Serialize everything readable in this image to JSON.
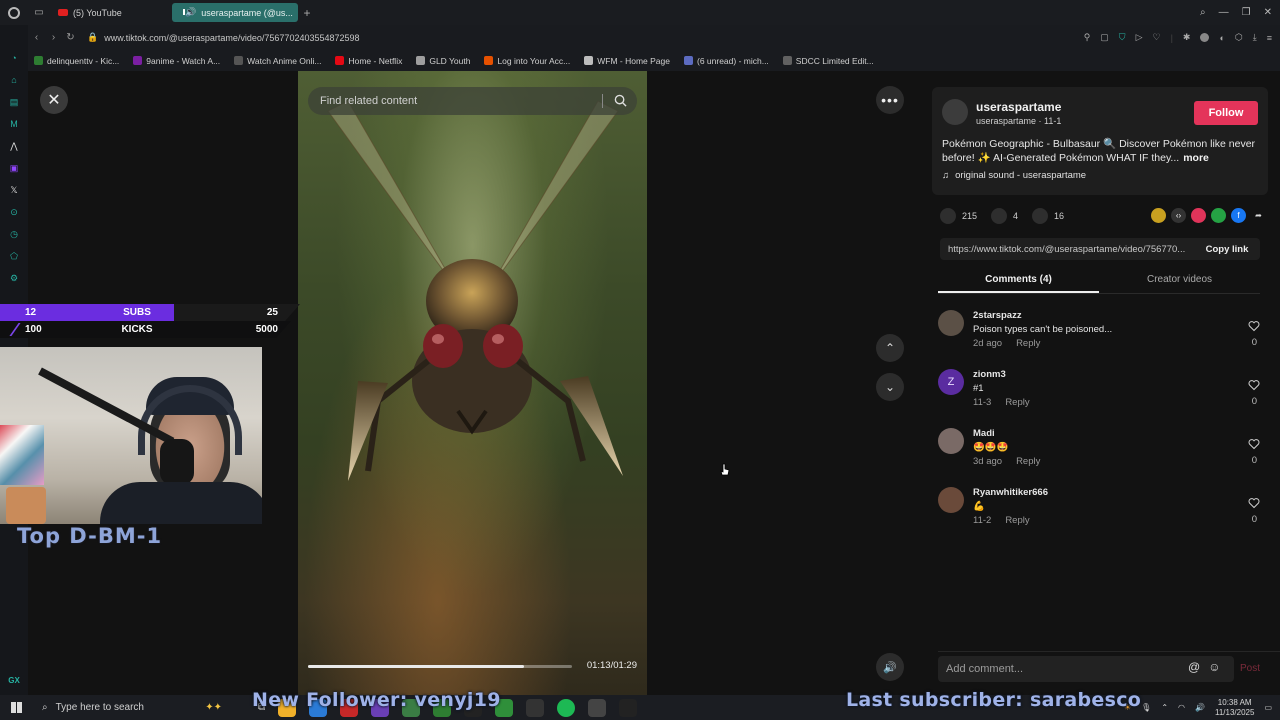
{
  "browser": {
    "tabs": [
      {
        "label": "(5) YouTube"
      },
      {
        "label": "useraspartame (@us..."
      }
    ],
    "new_tab": "+",
    "url": "www.tiktok.com/@useraspartame/video/7567702403554872598",
    "bookmarks": [
      {
        "label": "delinquenttv - Kic...",
        "color": "#2e7d32"
      },
      {
        "label": "9anime - Watch A...",
        "color": "#7b1fa2"
      },
      {
        "label": "Watch Anime Onli...",
        "color": "#555555"
      },
      {
        "label": "Home - Netflix",
        "color": "#e50914"
      },
      {
        "label": "GLD Youth",
        "color": "#9e9e9e"
      },
      {
        "label": "Log into Your Acc...",
        "color": "#e65100"
      },
      {
        "label": "WFM - Home Page",
        "color": "#bdbdbd"
      },
      {
        "label": "(6 unread) - mich...",
        "color": "#5c6bc0"
      },
      {
        "label": "SDCC Limited Edit...",
        "color": "#616161"
      }
    ],
    "sidebar_bottom": "GX"
  },
  "video": {
    "search_placeholder": "Find related content",
    "time": "01:13/01:29",
    "progress": 0.82
  },
  "post": {
    "username": "useraspartame",
    "subline": "useraspartame · 11-1",
    "follow_label": "Follow",
    "description": "Pokémon Geographic - Bulbasaur 🔍 Discover Pokémon like never before! ✨ AI-Generated Pokémon WHAT IF they...",
    "more_label": "more",
    "sound": "original sound - useraspartame",
    "likes": "215",
    "comments_count": "4",
    "saves": "16",
    "link": "https://www.tiktok.com/@useraspartame/video/756770...",
    "copy_label": "Copy link",
    "tab_comments": "Comments (4)",
    "tab_creator": "Creator videos"
  },
  "comments": [
    {
      "name": "2starspazz",
      "text": "Poison types can't be poisoned...",
      "date": "2d ago",
      "reply": "Reply",
      "likes": "0",
      "avatar_color": "#5b5046"
    },
    {
      "name": "zionm3",
      "text": "#1",
      "date": "11-3",
      "reply": "Reply",
      "likes": "0",
      "avatar_color": "#5a2ca0",
      "initial": "Z"
    },
    {
      "name": "Madi",
      "text": "🤩🤩🤩",
      "date": "3d ago",
      "reply": "Reply",
      "likes": "0",
      "avatar_color": "#7a6a66"
    },
    {
      "name": "Ryanwhitiker666",
      "text": "💪",
      "date": "11-2",
      "reply": "Reply",
      "likes": "0",
      "avatar_color": "#6a4a3a"
    }
  ],
  "add_comment": {
    "placeholder": "Add comment...",
    "post_label": "Post"
  },
  "stream": {
    "goal1": {
      "a": "12",
      "b": "SUBS",
      "c": "25"
    },
    "goal2": {
      "a": "100",
      "b": "KICKS",
      "c": "5000"
    },
    "top_label": "Top D-BM-1",
    "new_follower": "New Follower: venyj19",
    "last_subscriber": "Last subscriber: sarabesco"
  },
  "taskbar": {
    "search_placeholder": "Type here to search",
    "time": "10:38 AM",
    "date": "11/13/2025"
  }
}
